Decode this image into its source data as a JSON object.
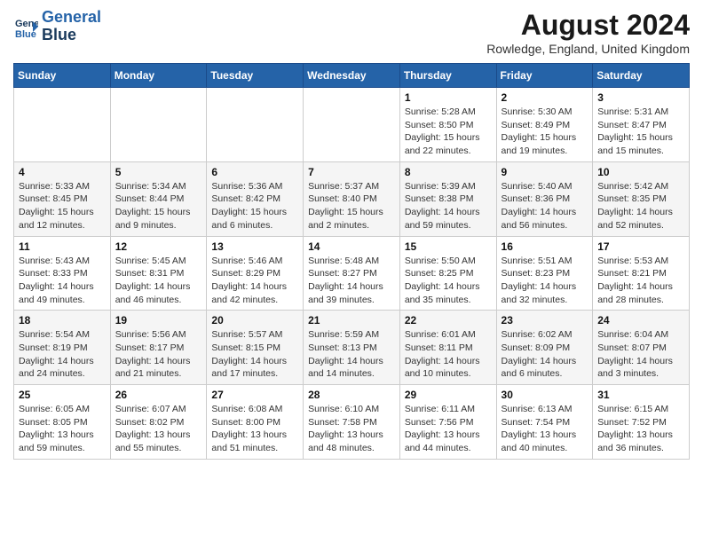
{
  "header": {
    "logo_line1": "General",
    "logo_line2": "Blue",
    "main_title": "August 2024",
    "subtitle": "Rowledge, England, United Kingdom"
  },
  "weekdays": [
    "Sunday",
    "Monday",
    "Tuesday",
    "Wednesday",
    "Thursday",
    "Friday",
    "Saturday"
  ],
  "weeks": [
    [
      {
        "day": "",
        "info": ""
      },
      {
        "day": "",
        "info": ""
      },
      {
        "day": "",
        "info": ""
      },
      {
        "day": "",
        "info": ""
      },
      {
        "day": "1",
        "info": "Sunrise: 5:28 AM\nSunset: 8:50 PM\nDaylight: 15 hours\nand 22 minutes."
      },
      {
        "day": "2",
        "info": "Sunrise: 5:30 AM\nSunset: 8:49 PM\nDaylight: 15 hours\nand 19 minutes."
      },
      {
        "day": "3",
        "info": "Sunrise: 5:31 AM\nSunset: 8:47 PM\nDaylight: 15 hours\nand 15 minutes."
      }
    ],
    [
      {
        "day": "4",
        "info": "Sunrise: 5:33 AM\nSunset: 8:45 PM\nDaylight: 15 hours\nand 12 minutes."
      },
      {
        "day": "5",
        "info": "Sunrise: 5:34 AM\nSunset: 8:44 PM\nDaylight: 15 hours\nand 9 minutes."
      },
      {
        "day": "6",
        "info": "Sunrise: 5:36 AM\nSunset: 8:42 PM\nDaylight: 15 hours\nand 6 minutes."
      },
      {
        "day": "7",
        "info": "Sunrise: 5:37 AM\nSunset: 8:40 PM\nDaylight: 15 hours\nand 2 minutes."
      },
      {
        "day": "8",
        "info": "Sunrise: 5:39 AM\nSunset: 8:38 PM\nDaylight: 14 hours\nand 59 minutes."
      },
      {
        "day": "9",
        "info": "Sunrise: 5:40 AM\nSunset: 8:36 PM\nDaylight: 14 hours\nand 56 minutes."
      },
      {
        "day": "10",
        "info": "Sunrise: 5:42 AM\nSunset: 8:35 PM\nDaylight: 14 hours\nand 52 minutes."
      }
    ],
    [
      {
        "day": "11",
        "info": "Sunrise: 5:43 AM\nSunset: 8:33 PM\nDaylight: 14 hours\nand 49 minutes."
      },
      {
        "day": "12",
        "info": "Sunrise: 5:45 AM\nSunset: 8:31 PM\nDaylight: 14 hours\nand 46 minutes."
      },
      {
        "day": "13",
        "info": "Sunrise: 5:46 AM\nSunset: 8:29 PM\nDaylight: 14 hours\nand 42 minutes."
      },
      {
        "day": "14",
        "info": "Sunrise: 5:48 AM\nSunset: 8:27 PM\nDaylight: 14 hours\nand 39 minutes."
      },
      {
        "day": "15",
        "info": "Sunrise: 5:50 AM\nSunset: 8:25 PM\nDaylight: 14 hours\nand 35 minutes."
      },
      {
        "day": "16",
        "info": "Sunrise: 5:51 AM\nSunset: 8:23 PM\nDaylight: 14 hours\nand 32 minutes."
      },
      {
        "day": "17",
        "info": "Sunrise: 5:53 AM\nSunset: 8:21 PM\nDaylight: 14 hours\nand 28 minutes."
      }
    ],
    [
      {
        "day": "18",
        "info": "Sunrise: 5:54 AM\nSunset: 8:19 PM\nDaylight: 14 hours\nand 24 minutes."
      },
      {
        "day": "19",
        "info": "Sunrise: 5:56 AM\nSunset: 8:17 PM\nDaylight: 14 hours\nand 21 minutes."
      },
      {
        "day": "20",
        "info": "Sunrise: 5:57 AM\nSunset: 8:15 PM\nDaylight: 14 hours\nand 17 minutes."
      },
      {
        "day": "21",
        "info": "Sunrise: 5:59 AM\nSunset: 8:13 PM\nDaylight: 14 hours\nand 14 minutes."
      },
      {
        "day": "22",
        "info": "Sunrise: 6:01 AM\nSunset: 8:11 PM\nDaylight: 14 hours\nand 10 minutes."
      },
      {
        "day": "23",
        "info": "Sunrise: 6:02 AM\nSunset: 8:09 PM\nDaylight: 14 hours\nand 6 minutes."
      },
      {
        "day": "24",
        "info": "Sunrise: 6:04 AM\nSunset: 8:07 PM\nDaylight: 14 hours\nand 3 minutes."
      }
    ],
    [
      {
        "day": "25",
        "info": "Sunrise: 6:05 AM\nSunset: 8:05 PM\nDaylight: 13 hours\nand 59 minutes."
      },
      {
        "day": "26",
        "info": "Sunrise: 6:07 AM\nSunset: 8:02 PM\nDaylight: 13 hours\nand 55 minutes."
      },
      {
        "day": "27",
        "info": "Sunrise: 6:08 AM\nSunset: 8:00 PM\nDaylight: 13 hours\nand 51 minutes."
      },
      {
        "day": "28",
        "info": "Sunrise: 6:10 AM\nSunset: 7:58 PM\nDaylight: 13 hours\nand 48 minutes."
      },
      {
        "day": "29",
        "info": "Sunrise: 6:11 AM\nSunset: 7:56 PM\nDaylight: 13 hours\nand 44 minutes."
      },
      {
        "day": "30",
        "info": "Sunrise: 6:13 AM\nSunset: 7:54 PM\nDaylight: 13 hours\nand 40 minutes."
      },
      {
        "day": "31",
        "info": "Sunrise: 6:15 AM\nSunset: 7:52 PM\nDaylight: 13 hours\nand 36 minutes."
      }
    ]
  ]
}
